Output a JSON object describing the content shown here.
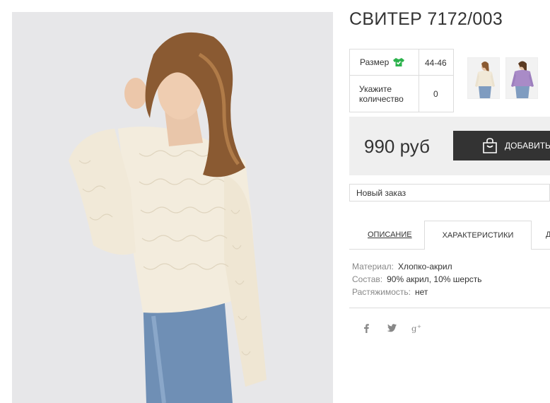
{
  "product": {
    "title": "СВИТЕР 7172/003"
  },
  "options": {
    "size_label": "Размер",
    "size_value": "44-46",
    "qty_label_line1": "Укажите",
    "qty_label_line2": "количество",
    "qty_value": "0"
  },
  "price": {
    "value": "990 руб",
    "add_button_label": "ДОБАВИТЬ"
  },
  "order": {
    "selected": "Новый заказ"
  },
  "tabs": [
    {
      "label": "ОПИСАНИЕ"
    },
    {
      "label": "ХАРАКТЕРИСТИКИ"
    },
    {
      "label": "Д"
    }
  ],
  "characteristics": [
    {
      "key": "Материал:",
      "value": "Хлопко-акрил"
    },
    {
      "key": "Состав:",
      "value": "90% акрил, 10% шерсть"
    },
    {
      "key": "Растяжимость:",
      "value": "нет"
    }
  ],
  "social": {
    "icons": [
      "facebook-icon",
      "twitter-icon",
      "google-plus-icon"
    ],
    "glyphs": [
      "f",
      "𝕥",
      "g+"
    ]
  },
  "colors": {
    "accent_dark": "#333333",
    "size_icon_green": "#2bb24c",
    "price_bg": "#efefef"
  }
}
